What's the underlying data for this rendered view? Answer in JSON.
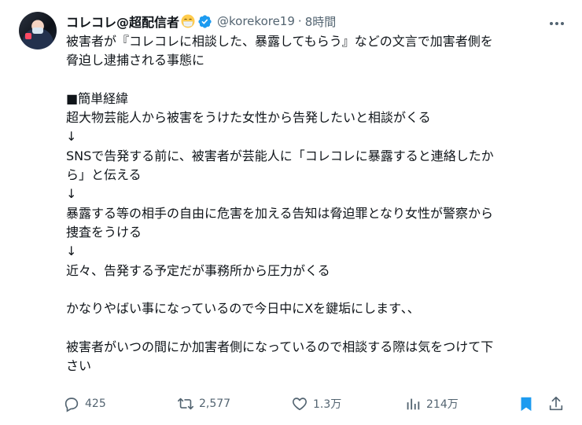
{
  "author": {
    "display_name": "コレコレ@超配信者",
    "handle": "@korekore19",
    "separator": "·",
    "time": "8時間",
    "verified": true
  },
  "tweet": {
    "lines": [
      "被害者が『コレコレに相談した、暴露してもらう』などの文言で加害者側を",
      "脅迫し逮捕される事態に",
      "",
      "■簡単経緯",
      "超大物芸能人から被害をうけた女性から告発したいと相談がくる",
      "↓",
      "SNSで告発する前に、被害者が芸能人に「コレコレに暴露すると連絡したか",
      "ら」と伝える",
      "↓",
      "暴露する等の相手の自由に危害を加える告知は脅迫罪となり女性が警察から",
      "捜査をうける",
      "↓",
      "近々、告発する予定だが事務所から圧力がくる",
      "",
      "かなりやばい事になっているので今日中にXを鍵垢にします､､",
      "",
      "被害者がいつの間にか加害者側になっているので相談する際は気をつけて下",
      "さい"
    ]
  },
  "actions": {
    "replies": "425",
    "retweets": "2,577",
    "likes": "1.3万",
    "views": "214万"
  },
  "icons": {
    "avatar": "avatar",
    "mask_emoji": "face-with-medical-mask-icon",
    "verified": "verified-badge-icon",
    "more": "more-options-icon",
    "reply": "reply-icon",
    "retweet": "retweet-icon",
    "like": "heart-icon",
    "views": "views-bar-chart-icon",
    "bookmark": "bookmark-icon",
    "share": "share-icon"
  },
  "colors": {
    "text": "#0f1419",
    "secondary": "#536471",
    "verified_blue": "#1d9bf0",
    "bookmark_blue": "#1d9bf0"
  }
}
